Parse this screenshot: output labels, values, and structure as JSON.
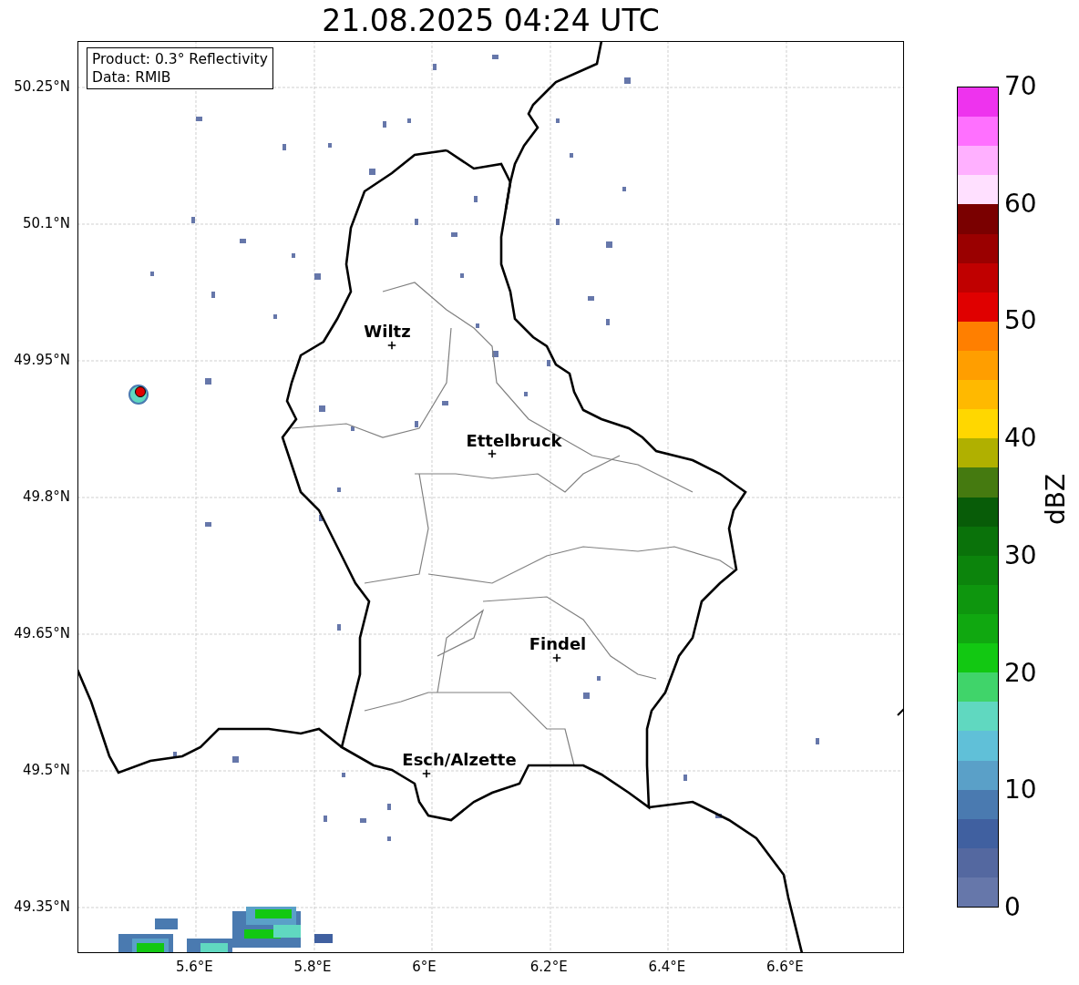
{
  "title": "21.08.2025 04:24 UTC",
  "info_box": {
    "lines": [
      "Product: 0.3° Reflectivity",
      "Data: RMIB"
    ]
  },
  "y_ticks": [
    "50.25°N",
    "50.1°N",
    "49.95°N",
    "49.8°N",
    "49.65°N",
    "49.5°N",
    "49.35°N"
  ],
  "x_ticks": [
    "5.6°E",
    "5.8°E",
    "6°E",
    "6.2°E",
    "6.4°E",
    "6.6°E"
  ],
  "cities": [
    {
      "name": "Wiltz"
    },
    {
      "name": "Ettelbruck"
    },
    {
      "name": "Findel"
    },
    {
      "name": "Esch/Alzette"
    }
  ],
  "colorbar": {
    "label": "dBZ",
    "ticks": [
      "70",
      "60",
      "50",
      "40",
      "30",
      "20",
      "10",
      "0"
    ],
    "segments": [
      {
        "color": "#ee33ee"
      },
      {
        "color": "#ff70ff"
      },
      {
        "color": "#ffb0ff"
      },
      {
        "color": "#ffe0ff"
      },
      {
        "color": "#7a0000"
      },
      {
        "color": "#9a0000"
      },
      {
        "color": "#c00000"
      },
      {
        "color": "#e00000"
      },
      {
        "color": "#ff7f00"
      },
      {
        "color": "#ff9e00"
      },
      {
        "color": "#ffb900"
      },
      {
        "color": "#ffd700"
      },
      {
        "color": "#b0b000"
      },
      {
        "color": "#457a10"
      },
      {
        "color": "#085c08"
      },
      {
        "color": "#0a720a"
      },
      {
        "color": "#0c840c"
      },
      {
        "color": "#0e960e"
      },
      {
        "color": "#10a810"
      },
      {
        "color": "#12c812"
      },
      {
        "color": "#40d46a"
      },
      {
        "color": "#60d8c0"
      },
      {
        "color": "#60c0d8"
      },
      {
        "color": "#5aa0c8"
      },
      {
        "color": "#4a7ab0"
      },
      {
        "color": "#4060a0"
      },
      {
        "color": "#5468a0"
      },
      {
        "color": "#6677aa"
      }
    ]
  }
}
